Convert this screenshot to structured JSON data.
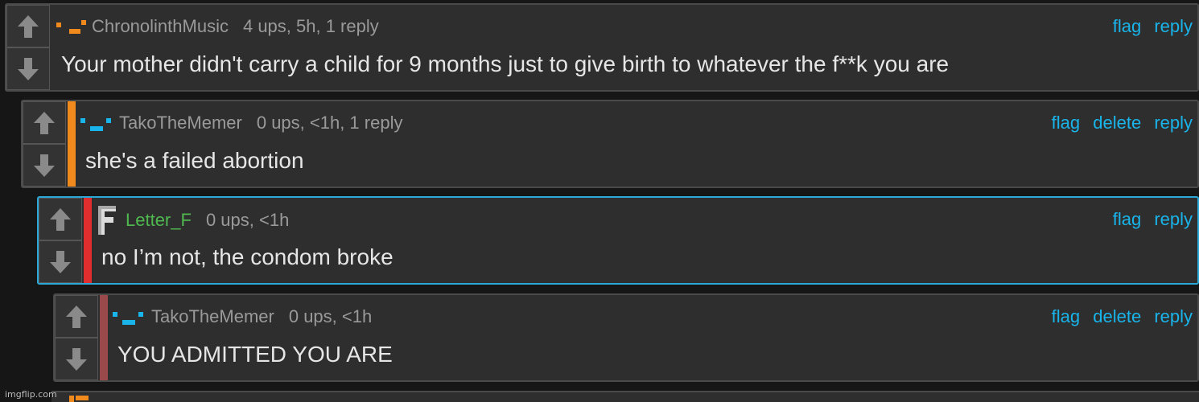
{
  "colors": {
    "background": "#161616",
    "panel": "#2e2e2e",
    "link": "#19b4ea",
    "meta_text": "#9a9a9a",
    "highlight_border": "#2aa9d9"
  },
  "comments": [
    {
      "username": "ChronolinthMusic",
      "stats": "4 ups, 5h, 1 reply",
      "text": "Your mother didn't carry a child for 9 months just to give birth to whatever the f**k you are",
      "avatar": "orange-pixel-face-icon",
      "actions": {
        "flag": "flag",
        "reply": "reply"
      }
    },
    {
      "username": "TakoTheMemer",
      "stats": "0 ups, <1h, 1 reply",
      "text": "she's a failed abortion",
      "avatar": "blue-pixel-face-icon",
      "actions": {
        "flag": "flag",
        "delete": "delete",
        "reply": "reply"
      }
    },
    {
      "username": "Letter_F",
      "stats": "0 ups, <1h",
      "text": "no I’m not, the condom broke",
      "avatar": "letter-f-icon",
      "actions": {
        "flag": "flag",
        "reply": "reply"
      }
    },
    {
      "username": "TakoTheMemer",
      "stats": "0 ups, <1h",
      "text": "YOU ADMITTED YOU ARE",
      "avatar": "blue-pixel-face-icon",
      "actions": {
        "flag": "flag",
        "delete": "delete",
        "reply": "reply"
      }
    }
  ],
  "watermark": "imgflip.com"
}
